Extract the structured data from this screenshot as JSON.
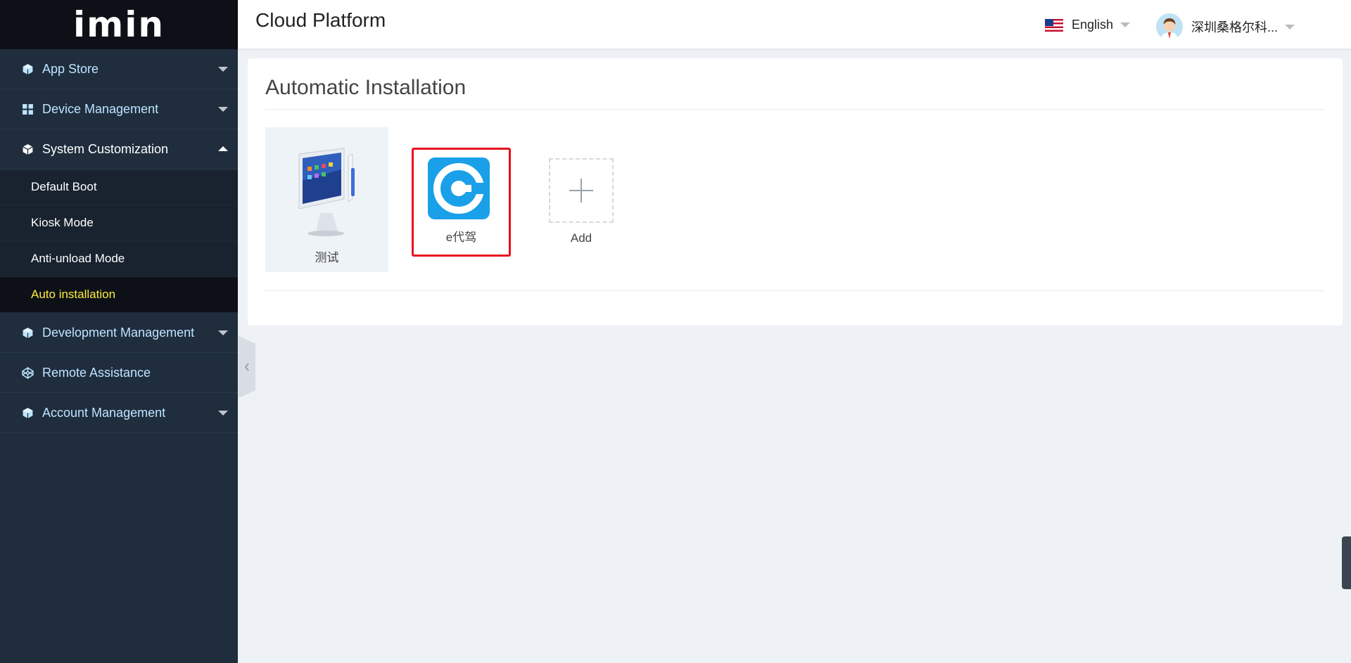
{
  "logo": {
    "text": "imin"
  },
  "sidebar": {
    "items": [
      {
        "label": "App Store",
        "icon": "cube-icon",
        "state": "collapsed"
      },
      {
        "label": "Device Management",
        "icon": "grid-icon",
        "state": "collapsed"
      },
      {
        "label": "System Customization",
        "icon": "cube-icon",
        "state": "expanded",
        "children": [
          {
            "label": "Default Boot"
          },
          {
            "label": "Kiosk Mode"
          },
          {
            "label": "Anti-unload Mode"
          },
          {
            "label": "Auto installation",
            "active": true
          }
        ]
      },
      {
        "label": "Development Management",
        "icon": "cube-icon",
        "state": "collapsed"
      },
      {
        "label": "Remote Assistance",
        "icon": "codepen-icon"
      },
      {
        "label": "Account Management",
        "icon": "cube-icon",
        "state": "collapsed"
      }
    ]
  },
  "header": {
    "title": "Cloud Platform",
    "language": "English",
    "user": "深圳桑格尔科..."
  },
  "main": {
    "title": "Automatic Installation",
    "apps": [
      {
        "label": "测试",
        "icon": "pos-device-icon"
      },
      {
        "label": "e代驾",
        "icon": "e-daijia-app-icon",
        "highlighted": true
      }
    ],
    "add_label": "Add"
  },
  "colors": {
    "sidebar_bg": "#1f2d3d",
    "sidebar_text": "#bfe4ff",
    "active_text": "#ffeb3b",
    "highlight_border": "#e8101e",
    "app_icon_blue": "#1aa0e8",
    "page_bg": "#eef2f6"
  }
}
